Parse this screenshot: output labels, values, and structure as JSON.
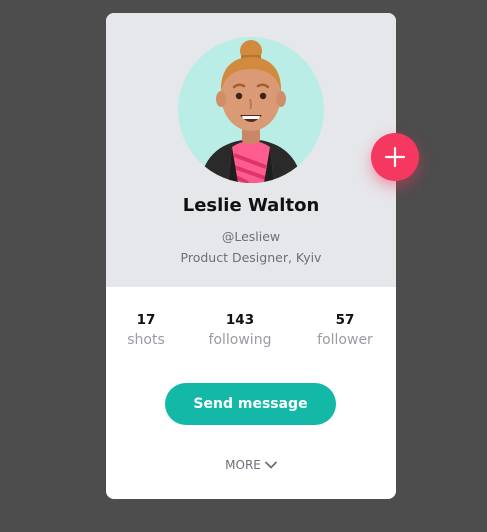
{
  "profile": {
    "name": "Leslie Walton",
    "handle": "@Lesliew",
    "role": "Product Designer, Kyiv"
  },
  "stats": [
    {
      "value": "17",
      "label": "shots"
    },
    {
      "value": "143",
      "label": "following"
    },
    {
      "value": "57",
      "label": "follower"
    }
  ],
  "actions": {
    "send_label": "Send message",
    "more_label": "MORE"
  },
  "icons": {
    "add": "plus-icon",
    "more": "chevron-down-icon"
  },
  "colors": {
    "background": "#4d4d4d",
    "card_top": "#e6e7eb",
    "avatar_bg": "#b9ede5",
    "accent_add": "#f5385f",
    "accent_send": "#14b8a6"
  }
}
